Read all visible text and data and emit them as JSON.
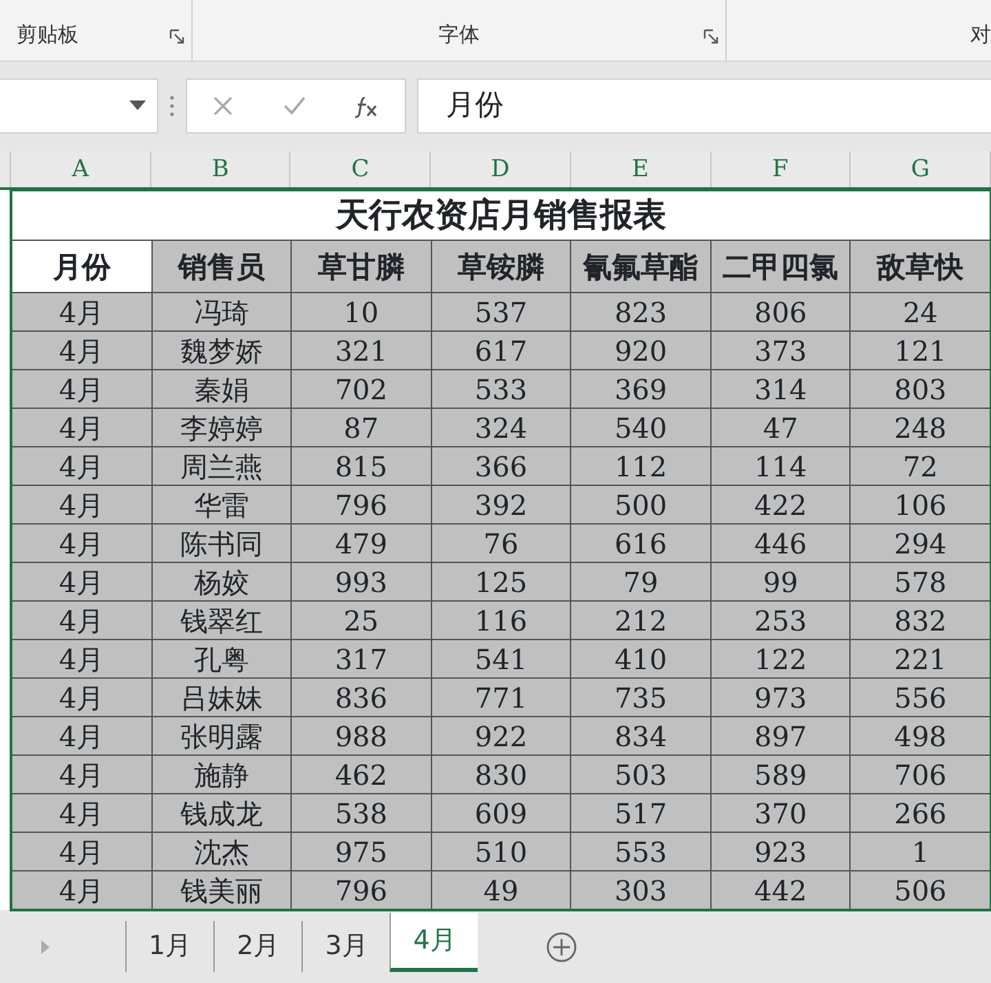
{
  "ribbon": {
    "groups": [
      {
        "label": "剪贴板",
        "launcher": true
      },
      {
        "label": "字体",
        "launcher": true
      },
      {
        "label": "对",
        "launcher": false
      }
    ]
  },
  "formula_bar": {
    "formula": "月份"
  },
  "column_headers": [
    "A",
    "B",
    "C",
    "D",
    "E",
    "F",
    "G"
  ],
  "sheet": {
    "title": "天行农资店月销售报表",
    "range_selected": true,
    "header": [
      {
        "text": "月份",
        "active": true
      },
      {
        "text": "销售员",
        "active": false
      },
      {
        "text": "草甘膦",
        "active": false
      },
      {
        "text": "草铵膦",
        "active": false
      },
      {
        "text": "氰氟草酯",
        "active": false
      },
      {
        "text": "二甲四氯",
        "active": false
      },
      {
        "text": "敌草快",
        "active": false
      }
    ],
    "rows": [
      [
        "4月",
        "冯琦",
        "10",
        "537",
        "823",
        "806",
        "24"
      ],
      [
        "4月",
        "魏梦娇",
        "321",
        "617",
        "920",
        "373",
        "121"
      ],
      [
        "4月",
        "秦娟",
        "702",
        "533",
        "369",
        "314",
        "803"
      ],
      [
        "4月",
        "李婷婷",
        "87",
        "324",
        "540",
        "47",
        "248"
      ],
      [
        "4月",
        "周兰燕",
        "815",
        "366",
        "112",
        "114",
        "72"
      ],
      [
        "4月",
        "华雷",
        "796",
        "392",
        "500",
        "422",
        "106"
      ],
      [
        "4月",
        "陈书同",
        "479",
        "76",
        "616",
        "446",
        "294"
      ],
      [
        "4月",
        "杨姣",
        "993",
        "125",
        "79",
        "99",
        "578"
      ],
      [
        "4月",
        "钱翠红",
        "25",
        "116",
        "212",
        "253",
        "832"
      ],
      [
        "4月",
        "孔粤",
        "317",
        "541",
        "410",
        "122",
        "221"
      ],
      [
        "4月",
        "吕妹妹",
        "836",
        "771",
        "735",
        "973",
        "556"
      ],
      [
        "4月",
        "张明露",
        "988",
        "922",
        "834",
        "897",
        "498"
      ],
      [
        "4月",
        "施静",
        "462",
        "830",
        "503",
        "589",
        "706"
      ],
      [
        "4月",
        "钱成龙",
        "538",
        "609",
        "517",
        "370",
        "266"
      ],
      [
        "4月",
        "沈杰",
        "975",
        "510",
        "553",
        "923",
        "1"
      ],
      [
        "4月",
        "钱美丽",
        "796",
        "49",
        "303",
        "442",
        "506"
      ]
    ]
  },
  "sheet_tabs": [
    {
      "label": "1月",
      "selected": false
    },
    {
      "label": "2月",
      "selected": false
    },
    {
      "label": "3月",
      "selected": false
    },
    {
      "label": "4月",
      "selected": true
    }
  ]
}
